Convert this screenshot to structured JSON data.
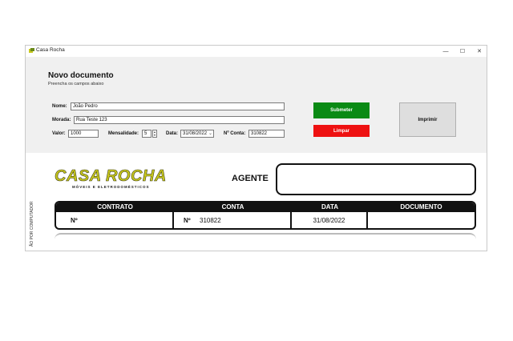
{
  "window": {
    "title": "Casa Rocha",
    "controls": {
      "minimize": "—",
      "maximize": "☐",
      "close": "✕"
    }
  },
  "form": {
    "title": "Novo documento",
    "subtitle": "Preencha os campos abaixo",
    "nome": {
      "label": "Nome:",
      "value": "João Pedro"
    },
    "morada": {
      "label": "Morada:",
      "value": "Rua Teste 123"
    },
    "valor": {
      "label": "Valor:",
      "value": "1000"
    },
    "mensalidade": {
      "label": "Mensalidade:",
      "value": "5"
    },
    "data": {
      "label": "Data:",
      "value": "31/08/2022"
    },
    "conta": {
      "label": "Nº Conta:",
      "value": "310822"
    }
  },
  "buttons": {
    "submit": "Submeter",
    "clear": "Limpar",
    "print": "Imprimir"
  },
  "preview": {
    "side_text": "ÃO POR COMPUTADOR",
    "logo": {
      "main": "CASA ROCHA",
      "sub": "MÓVEIS E ELETRODOMÉSTICOS"
    },
    "agent_label": "AGENTE",
    "table": {
      "headers": [
        "CONTRATO",
        "CONTA",
        "DATA",
        "DOCUMENTO"
      ],
      "contrato_prefix": "Nº",
      "conta_prefix": "Nº",
      "conta_value": "310822",
      "data_value": "31/08/2022",
      "documento_value": ""
    }
  },
  "colors": {
    "submit": "#0a8a14",
    "clear": "#ee1111",
    "logo": "#c8c81e",
    "panel": "#f0f0f0"
  }
}
